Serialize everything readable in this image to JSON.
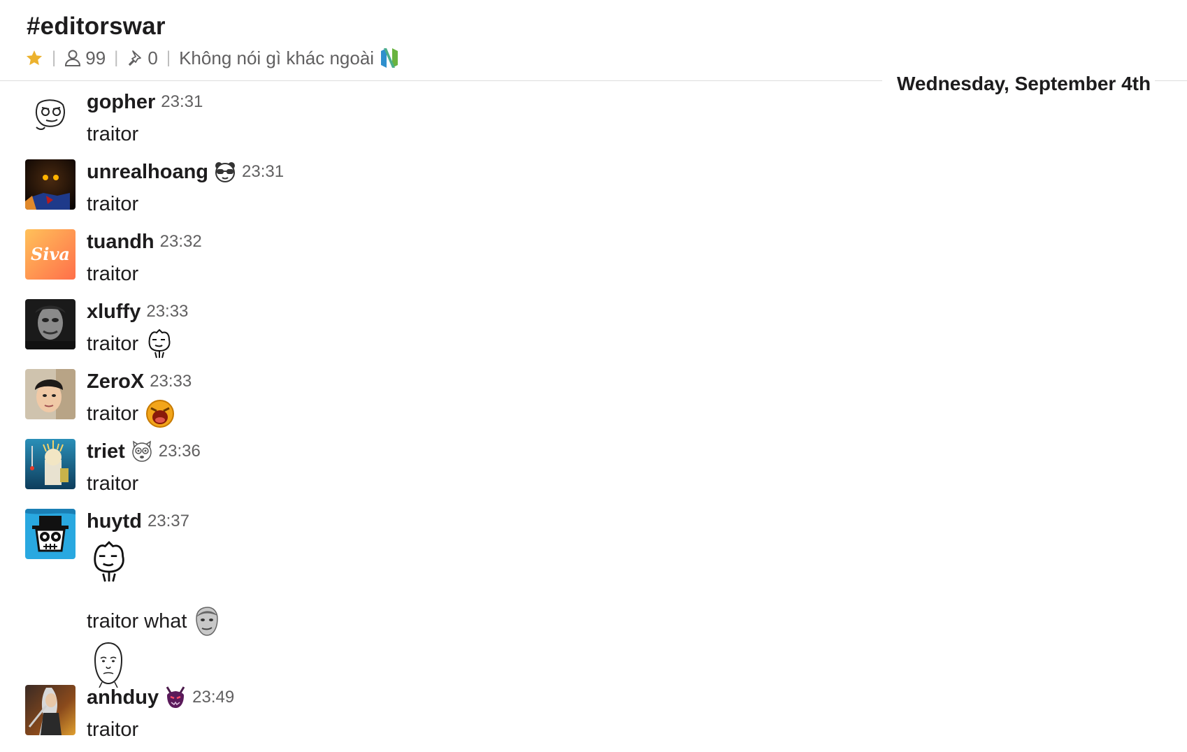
{
  "channel": {
    "title": "#editorswar",
    "members": "99",
    "pins": "0",
    "topic": "Không nói gì khác ngoài",
    "topic_icon": "neovim-logo-icon",
    "starred": true
  },
  "day_divider": "Wednesday, September 4th",
  "messages": [
    {
      "user": "gopher",
      "time": "23:31",
      "text": "traitor",
      "avatar": "rage-face-avatar"
    },
    {
      "user": "unrealhoang",
      "status_icon": "panda-sunglasses-icon",
      "time": "23:31",
      "text": "traitor",
      "avatar": "black-mage-avatar"
    },
    {
      "user": "tuandh",
      "time": "23:32",
      "text": "traitor",
      "avatar": "siva-logo-avatar",
      "avatar_text": "Siva"
    },
    {
      "user": "xluffy",
      "time": "23:33",
      "text": "traitor",
      "emoji": "doodle-face-emoji",
      "avatar": "joker-photo-avatar"
    },
    {
      "user": "ZeroX",
      "time": "23:33",
      "text": "traitor",
      "emoji": "shouting-face-emoji",
      "avatar": "person-photo-avatar"
    },
    {
      "user": "triet",
      "status_icon": "cat-face-icon",
      "time": "23:36",
      "text": "traitor",
      "avatar": "illustration-avatar"
    },
    {
      "user": "huytd",
      "time": "23:37",
      "avatar": "hat-skull-avatar",
      "lines": [
        {
          "type": "emoji",
          "emoji": "doodle-face-emoji"
        },
        {
          "type": "text",
          "text": "traitor what",
          "emoji": "kappa-face-emoji"
        },
        {
          "type": "emoji",
          "emoji": "okay-face-emoji"
        }
      ]
    },
    {
      "user": "anhduy",
      "status_icon": "purple-demon-icon",
      "time": "23:49",
      "text": "traitor",
      "avatar": "warrior-art-avatar"
    }
  ],
  "colors": {
    "star": "#ecb22e",
    "text": "#1d1c1d",
    "muted": "#616061",
    "divider": "#dddddd"
  }
}
